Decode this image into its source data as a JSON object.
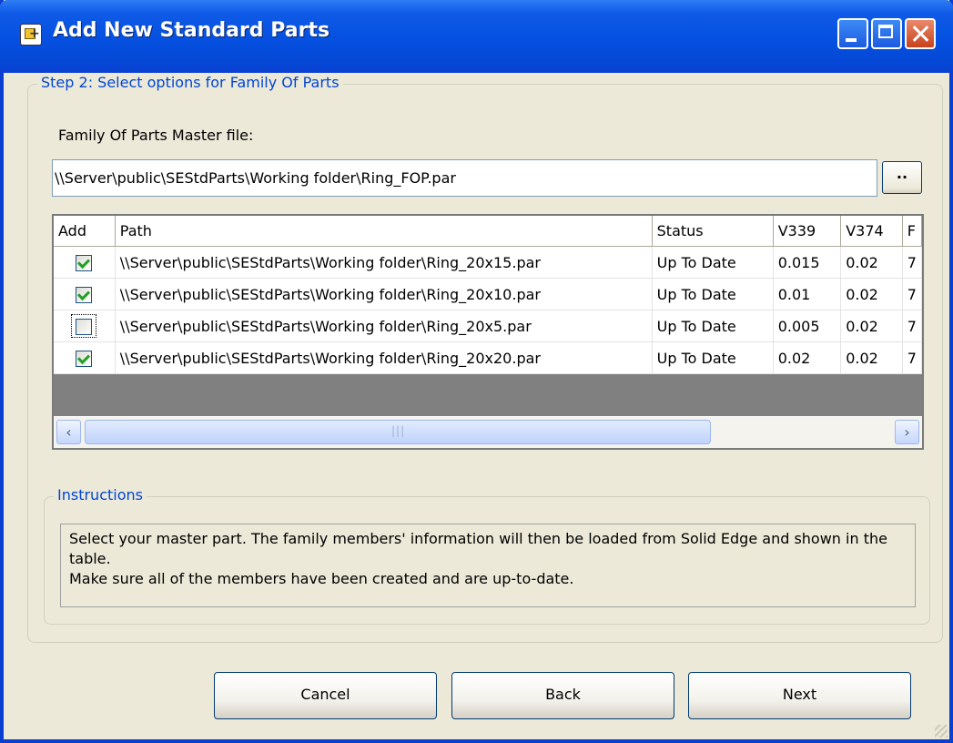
{
  "window": {
    "title": "Add New Standard Parts"
  },
  "step_group": {
    "title": "Step 2: Select options for Family Of Parts",
    "master_file_label": "Family Of Parts Master file:",
    "master_file_value": "\\\\Server\\public\\SEStdParts\\Working folder\\Ring_FOP.par",
    "browse_label": ".."
  },
  "table": {
    "columns": [
      "Add",
      "Path",
      "Status",
      "V339",
      "V374",
      "F"
    ],
    "rows": [
      {
        "checked": true,
        "path": "\\\\Server\\public\\SEStdParts\\Working folder\\Ring_20x15.par",
        "status": "Up To Date",
        "v339": "0.015",
        "v374": "0.02",
        "extra": "7"
      },
      {
        "checked": true,
        "path": "\\\\Server\\public\\SEStdParts\\Working folder\\Ring_20x10.par",
        "status": "Up To Date",
        "v339": "0.01",
        "v374": "0.02",
        "extra": "7"
      },
      {
        "checked": false,
        "path": "\\\\Server\\public\\SEStdParts\\Working folder\\Ring_20x5.par",
        "status": "Up To Date",
        "v339": "0.005",
        "v374": "0.02",
        "extra": "7"
      },
      {
        "checked": true,
        "path": "\\\\Server\\public\\SEStdParts\\Working folder\\Ring_20x20.par",
        "status": "Up To Date",
        "v339": "0.02",
        "v374": "0.02",
        "extra": "7"
      }
    ]
  },
  "instructions": {
    "title": "Instructions",
    "line1": "Select your master part. The family members' information will then be loaded from Solid Edge and shown in the table.",
    "line2": "Make sure all of the members have been created and are up-to-date."
  },
  "buttons": {
    "cancel": "Cancel",
    "back": "Back",
    "next": "Next"
  },
  "icons": {
    "app": "add-part-icon",
    "minimize": "minimize-icon",
    "maximize": "maximize-icon",
    "close": "close-icon",
    "scroll_left": "chevron-left-icon",
    "scroll_right": "chevron-right-icon"
  },
  "colors": {
    "title_bar": "#0550e0",
    "group_title": "#0046d5",
    "window_bg": "#ece9d8"
  }
}
